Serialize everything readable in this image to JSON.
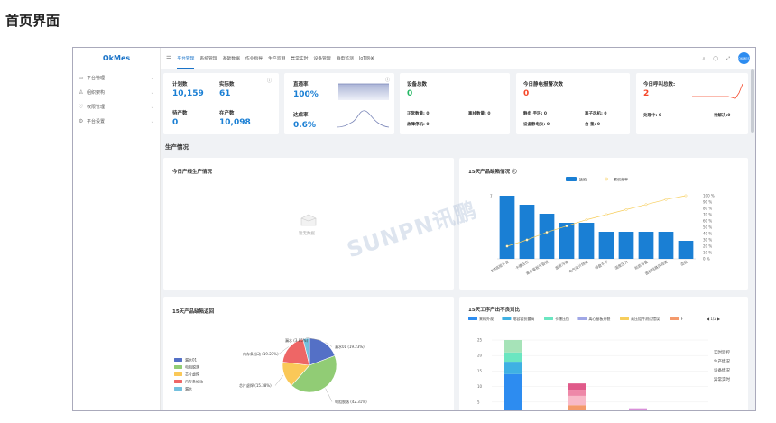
{
  "page_heading": "首页界面",
  "app": {
    "logo": "OkMes",
    "avatar": "OKMES"
  },
  "sidebar": {
    "items": [
      {
        "icon": "▭",
        "label": "平台管理"
      },
      {
        "icon": "♙",
        "label": "组织架构"
      },
      {
        "icon": "♡",
        "label": "权限管理"
      },
      {
        "icon": "⚙",
        "label": "平台设置"
      }
    ]
  },
  "topbar": {
    "tabs": [
      "平台管理",
      "系统管理",
      "基础数据",
      "作业指导",
      "生产监测",
      "异常实时",
      "设备管理",
      "静电监测",
      "IoT网关"
    ],
    "active_tab": 0
  },
  "kpis": {
    "plan_label": "计划数",
    "plan_value": "10,159",
    "actual_label": "实际数",
    "actual_value": "61",
    "pending_label": "待产数",
    "pending_value": "0",
    "inprod_label": "在产数",
    "inprod_value": "10,098",
    "passrate_label": "直通率",
    "passrate_value": "100%",
    "badrate_label": "达成率",
    "badrate_value": "0.6%",
    "equip_label": "设备总数",
    "equip_value": "0",
    "equip_normal": "正常数量: 0",
    "equip_offline": "离线数量: 0",
    "equip_fault": "故障停机: 0",
    "esd_label": "今日静电报警次数",
    "esd_value": "0",
    "esd_static": "静电  手环: 0",
    "esd_ion": "离子风机: 0",
    "esd_device": "设备静电仪: 0",
    "esd_table": "台   垫: 0",
    "call_label": "今日呼叫总数:",
    "call_value": "2",
    "call_processing": "处理中: 0",
    "call_unresolved": "待解决:0"
  },
  "section_title": "生产情况",
  "panels": {
    "today_title": "今日产线生产情况",
    "today_empty": "暂无数据",
    "defect_title": "15天产品缺陷情况 ⓘ",
    "defect_legend_bar": "缺陷",
    "defect_legend_line": "累积频率",
    "pie_title": "15天产品缺陷返回",
    "bottom_title": "15天工序产出不良对比",
    "bottom_pager": "1/2",
    "side_links": [
      "实时监控",
      "生产情况",
      "设备情况",
      "异常实时"
    ]
  },
  "chart_data": [
    {
      "type": "bar",
      "title": "15天产品缺陷情况",
      "categories": [
        "BM底版不良",
        "卡爆压伤",
        "离心基板开裂损",
        "面板污染",
        "电气设计缺陷",
        "焊盘不平",
        "温度压力",
        "贴装与叠",
        "面板线路开短路",
        "混贴"
      ],
      "series": [
        {
          "name": "缺陷",
          "values": [
            7,
            6,
            5,
            4,
            4,
            3,
            3,
            3,
            3,
            2
          ]
        },
        {
          "name": "累积频率",
          "values": [
            20,
            30,
            42,
            52,
            62,
            70,
            78,
            86,
            94,
            100
          ]
        }
      ],
      "ylim": [
        0,
        7
      ],
      "y2labels": [
        "0 %",
        "10 %",
        "20 %",
        "30 %",
        "40 %",
        "50 %",
        "60 %",
        "70 %",
        "80 %",
        "90 %",
        "100 %"
      ]
    },
    {
      "type": "pie",
      "title": "15天产品缺陷返回",
      "categories": [
        "漏水01",
        "电阻脱落",
        "芯片虚焊",
        "内存条松动",
        "漏水"
      ],
      "values": [
        19.23,
        42.31,
        15.38,
        19.23,
        3.85
      ],
      "labels": [
        "漏水01 (19.23%)",
        "电阻脱落 (42.31%)",
        "芯片虚焊 (15.38%)",
        "内存条松动 (19.23%)",
        "漏水 (3.85%)"
      ],
      "colors": [
        "#5470c6",
        "#91cc75",
        "#fac858",
        "#ee6666",
        "#73c0de"
      ]
    },
    {
      "type": "bar",
      "title": "15天工序产出不良对比",
      "legend": [
        "来料外观",
        "电容容抗偏高",
        "卡爆压伤",
        "离心基板开裂",
        "高压组件测试错误",
        "F"
      ],
      "legend_colors": [
        "#2d8cf0",
        "#3fb1e3",
        "#6be6c1",
        "#a0a7e6",
        "#f7ce5c",
        "#f49a6c"
      ],
      "ylabels": [
        "5",
        "10",
        "15",
        "20",
        "25"
      ],
      "ylim": [
        0,
        25
      ]
    }
  ]
}
